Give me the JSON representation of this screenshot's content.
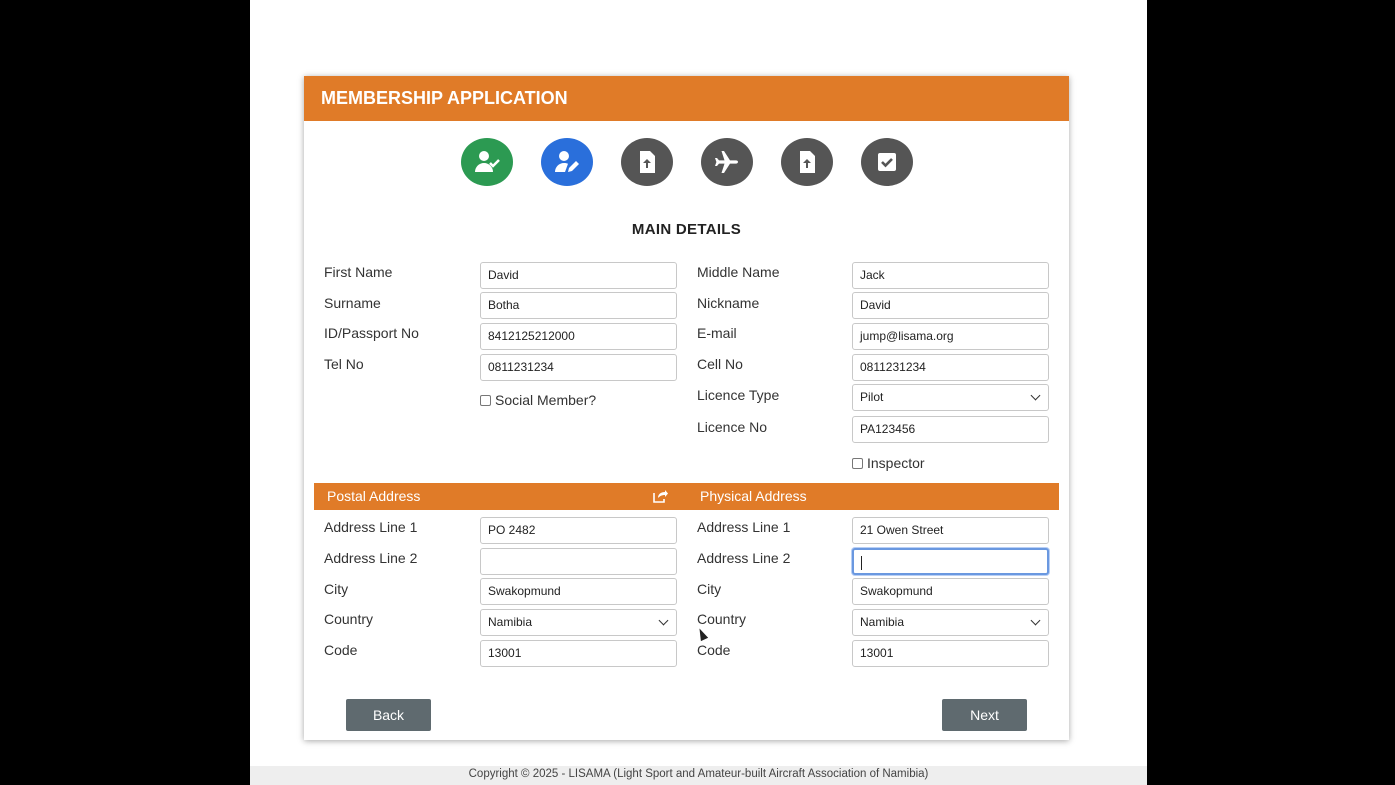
{
  "header": {
    "title": "MEMBERSHIP APPLICATION"
  },
  "steps": [
    {
      "icon": "user-check-icon",
      "state": "complete",
      "color": "#2c9a52"
    },
    {
      "icon": "user-edit-icon",
      "state": "active",
      "color": "#2a6fdb"
    },
    {
      "icon": "file-upload-icon",
      "state": "pending",
      "color": "#555555"
    },
    {
      "icon": "airplane-icon",
      "state": "pending",
      "color": "#555555"
    },
    {
      "icon": "file-upload-icon",
      "state": "pending",
      "color": "#555555"
    },
    {
      "icon": "check-square-icon",
      "state": "pending",
      "color": "#555555"
    }
  ],
  "section_title": "MAIN DETAILS",
  "main": {
    "first_name": {
      "label": "First Name",
      "value": "David"
    },
    "surname": {
      "label": "Surname",
      "value": "Botha"
    },
    "id_passport": {
      "label": "ID/Passport No",
      "value": "8412125212000"
    },
    "tel": {
      "label": "Tel No",
      "value": "0811231234"
    },
    "social_member": {
      "label": "Social Member?",
      "checked": false
    },
    "middle_name": {
      "label": "Middle Name",
      "value": "Jack"
    },
    "nickname": {
      "label": "Nickname",
      "value": "David"
    },
    "email": {
      "label": "E-mail",
      "value": "jump@lisama.org"
    },
    "cell": {
      "label": "Cell No",
      "value": "0811231234"
    },
    "licence_type": {
      "label": "Licence Type",
      "value": "Pilot"
    },
    "licence_no": {
      "label": "Licence No",
      "value": "PA123456"
    },
    "inspector": {
      "label": "Inspector",
      "checked": false
    }
  },
  "address_bar": {
    "postal": "Postal Address",
    "physical": "Physical Address"
  },
  "postal": {
    "line1": {
      "label": "Address Line 1",
      "value": "PO 2482"
    },
    "line2": {
      "label": "Address Line 2",
      "value": ""
    },
    "city": {
      "label": "City",
      "value": "Swakopmund"
    },
    "country": {
      "label": "Country",
      "value": "Namibia"
    },
    "code": {
      "label": "Code",
      "value": "13001"
    }
  },
  "physical": {
    "line1": {
      "label": "Address Line 1",
      "value": "21 Owen Street"
    },
    "line2": {
      "label": "Address Line 2",
      "value": ""
    },
    "city": {
      "label": "City",
      "value": "Swakopmund"
    },
    "country": {
      "label": "Country",
      "value": "Namibia"
    },
    "code": {
      "label": "Code",
      "value": "13001"
    }
  },
  "buttons": {
    "back": "Back",
    "next": "Next"
  },
  "footer": "Copyright © 2025 - LISAMA (Light Sport and Amateur-built Aircraft Association of Namibia)",
  "colors": {
    "accent": "#e07b28",
    "button": "#5f6a6f",
    "step_complete": "#2c9a52",
    "step_active": "#2a6fdb",
    "step_pending": "#555555"
  }
}
